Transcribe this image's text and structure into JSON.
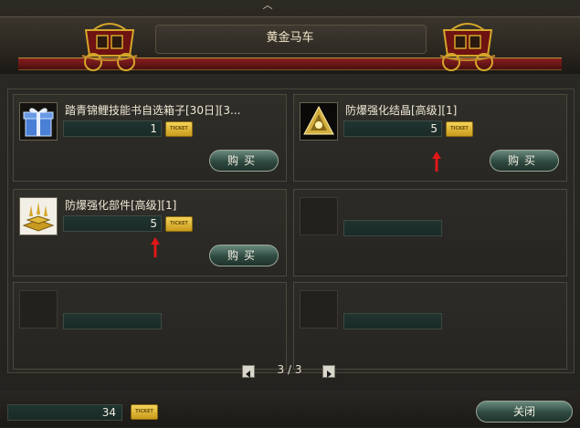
{
  "window": {
    "title": "黄金马车",
    "close_glyph": "︿"
  },
  "items": [
    {
      "name": "踏青锦鲤技能书自选箱子[30日][3...",
      "quantity": "1",
      "ticket_label": "TICKET",
      "buy_label": "购买",
      "icon": "blue-gift-box-icon"
    },
    {
      "name": "防爆强化结晶[高级][1]",
      "quantity": "5",
      "ticket_label": "TICKET",
      "buy_label": "购买",
      "icon": "gold-crystal-icon"
    },
    {
      "name": "防爆强化部件[高级][1]",
      "quantity": "5",
      "ticket_label": "TICKET",
      "buy_label": "购买",
      "icon": "gold-parts-icon"
    }
  ],
  "pager": {
    "text": "3 / 3"
  },
  "footer": {
    "quantity": "34",
    "ticket_label": "TICKET",
    "close_label": "关闭"
  },
  "colors": {
    "accent_red": "#8a1f1f",
    "gold": "#d4a62a",
    "button_green": "#2f4a41"
  }
}
